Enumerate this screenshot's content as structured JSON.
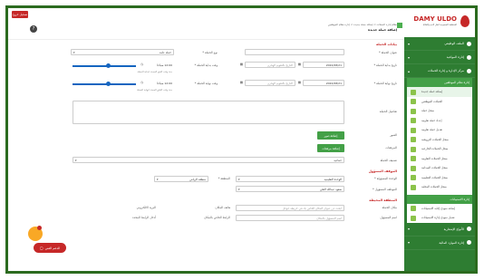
{
  "app": {
    "logo_text": "DAMY ULDO",
    "logo_sub": "المنظمة السعودية لنقل الدم والخلايا",
    "exit_label": "تسجيل خروج"
  },
  "sidebar": {
    "items": [
      {
        "label": "الملف الوظيفي"
      },
      {
        "label": "إدارة المواعيد"
      },
      {
        "label": "مركز الإدارة و إدارة الحملات"
      }
    ],
    "panel_header": "إدارة نظام الموظفين",
    "sub_items": [
      {
        "label": "إضافة حملة جديدة",
        "active": true
      },
      {
        "label": "الحملات الموظفين"
      },
      {
        "label": "سجل حملة"
      },
      {
        "label": "إعداد حملة تعاونية"
      },
      {
        "label": "تعديل حملة تعاونية"
      },
      {
        "label": "سجل الحملات الترويجية"
      },
      {
        "label": "سجل الحملات الخارجية"
      },
      {
        "label": "سجل الحملات التعاونية"
      },
      {
        "label": "سجل الحملات الميدانية"
      },
      {
        "label": "سجل الحملات التعليمية"
      },
      {
        "label": "سجل الحملات المحلية"
      }
    ],
    "panel2_header": "إدارة الاستبيانات",
    "panel2_items": [
      {
        "label": "إضافة نموذج إجابة الاستبيانات"
      },
      {
        "label": "تعديل نموذج إدارة الاستبيانات"
      }
    ],
    "bottom_items": [
      {
        "label": "الأنواع الإشعارية"
      },
      {
        "label": "إدارة الموارد المالية"
      }
    ]
  },
  "header": {
    "breadcrumb": "نظام إدارة الحملات > إضافة حملة جديدة > إدارة نظام الموظفين",
    "page_title": "إضافة حملة جديدة"
  },
  "form": {
    "section1": "بيانات الحملة",
    "campaign_name_label": "عنوان الحملة *",
    "campaign_type_label": "نوع الحملة *",
    "campaign_type_value": "حملة عامة",
    "start_date_label": "تاريخ بداية الحملة *",
    "start_date_value": "2022/08/21",
    "start_date_hijri": "التاريخ بالتقويم الهجري",
    "start_time_label": "وقت بداية الحملة *",
    "start_time_value": "12:00 صباحا",
    "start_time_hint": "حدد وقت الفتح المحدد لبداية الحملة",
    "end_date_label": "تاريخ نهاية الحملة *",
    "end_date_value": "2022/08/21",
    "end_date_hijri": "التاريخ بالتقويم الهجري",
    "end_time_label": "وقت نهاية الحملة *",
    "end_time_value": "12:00 صباحا",
    "end_time_hint": "حدد وقت الغلق المحدد لنهاية الحملة",
    "description_label": "تفاصيل الحملة",
    "images_label": "الصور",
    "images_button": "إضافة صور",
    "attachments_label": "المرفقات",
    "attachments_button": "إضافة مرفقات",
    "status_label": "تصنيف الحملة",
    "status_value": "جماعية",
    "section2": "الموقف المسؤول",
    "unit_label": "الوحدة المسؤولة *",
    "unit_value": "الوحدة التعليمية",
    "region_label": "المنطقة *",
    "region_value": "منطقة الرياض",
    "branch_label": "الموظف المسؤول *",
    "branch_value": "سعود عبدالله العلي",
    "section3": "المنطقة المحيطة",
    "address_label": "مكان الحملة",
    "address_placeholder": "ابحث عن عنوان المكان الخاص بك في خريطة جوجل",
    "mobile_label": "هاتف المكان",
    "mobile_value": "أرقام فقط",
    "email_label": "البريد الالكتروني",
    "email_placeholder": "البريد الالكتروني الخاص بالمكان",
    "map_label": "الرابط الخاص بالمكان",
    "map_value": "أدخل الرابط المحدد",
    "contact_label": "اسم المسؤول",
    "contact_value": "اسم المسؤول بالمكان"
  },
  "float": {
    "support_label": "الدعم الفني"
  }
}
